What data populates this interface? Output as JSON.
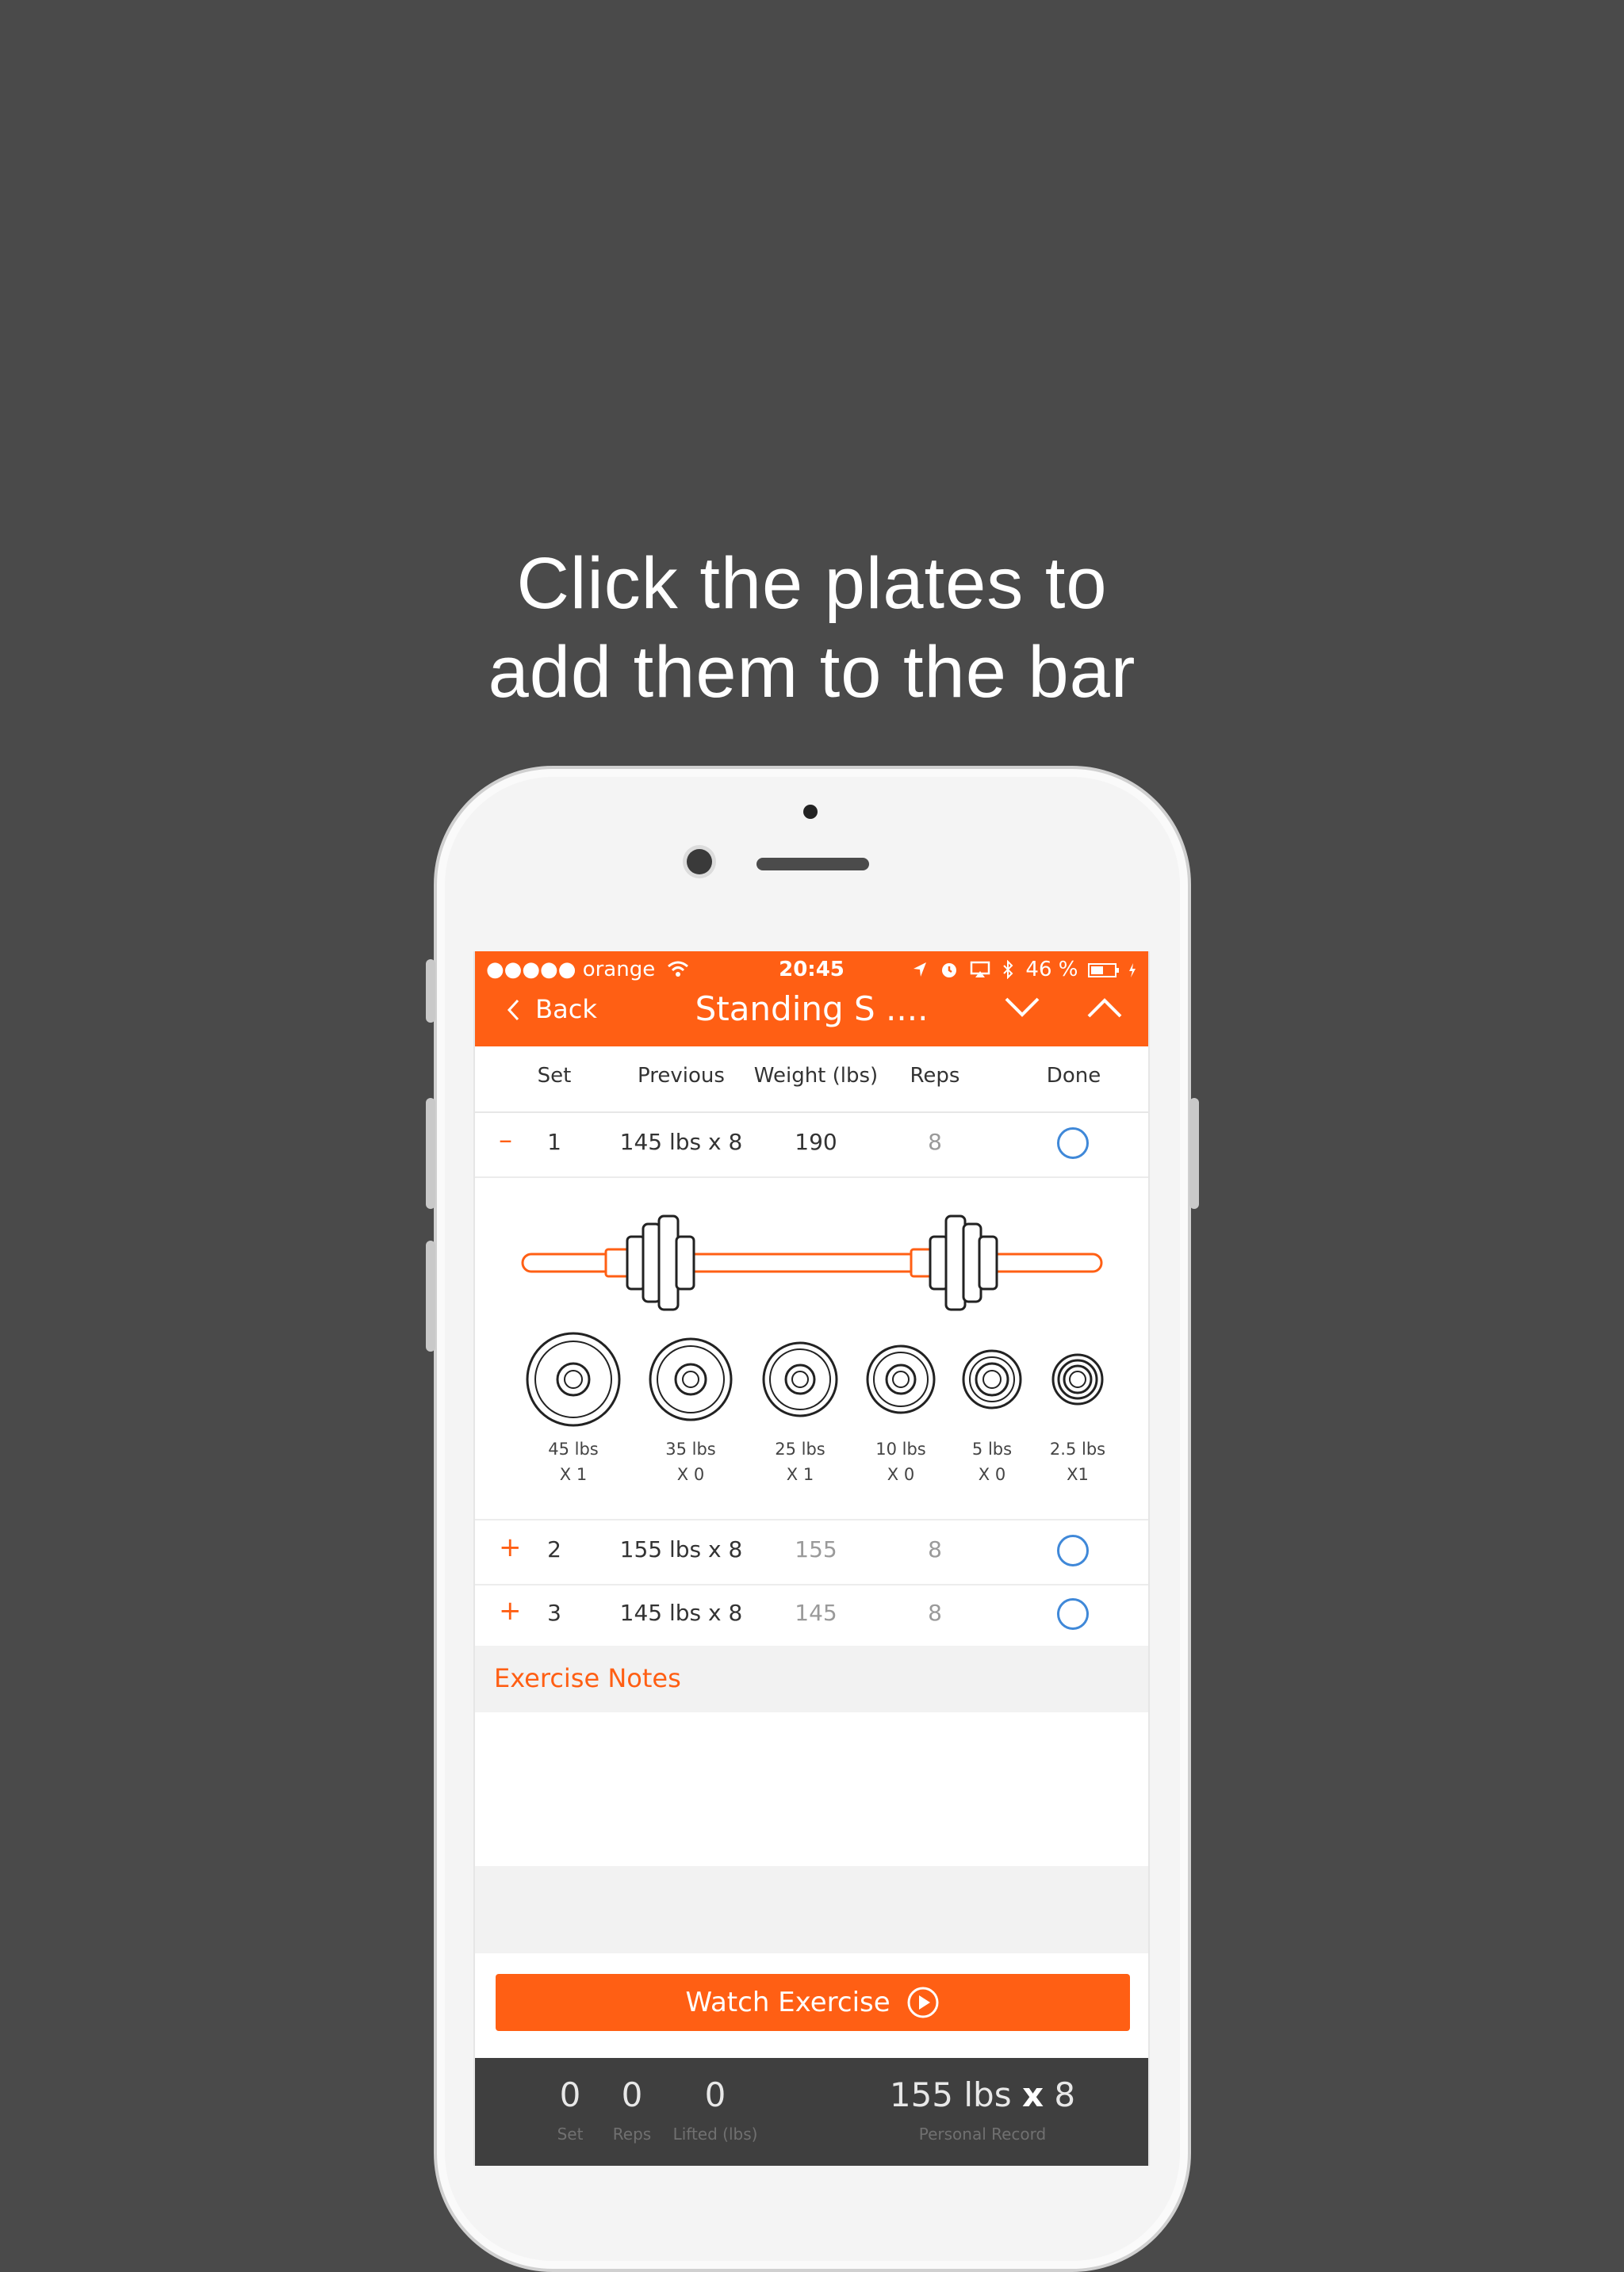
{
  "headline": {
    "line1": "Click the plates to",
    "line2": "add them to the bar"
  },
  "status_bar": {
    "carrier": "●●●●● orange",
    "time": "20:45",
    "battery": "46 %"
  },
  "nav": {
    "back_label": "Back",
    "title": "Standing S ...."
  },
  "table": {
    "headers": {
      "set": "Set",
      "previous": "Previous",
      "weight": "Weight (lbs)",
      "reps": "Reps",
      "done": "Done"
    },
    "rows": [
      {
        "sign": "–",
        "set": "1",
        "previous": "145 lbs x 8",
        "weight": "190",
        "reps": "8"
      },
      {
        "sign": "+",
        "set": "2",
        "previous": "155 lbs x 8",
        "weight": "155",
        "reps": "8"
      },
      {
        "sign": "+",
        "set": "3",
        "previous": "145 lbs x 8",
        "weight": "145",
        "reps": "8"
      }
    ]
  },
  "plates": [
    {
      "weight": "45 lbs",
      "count": "X 1"
    },
    {
      "weight": "35 lbs",
      "count": "X 0"
    },
    {
      "weight": "25 lbs",
      "count": "X 1"
    },
    {
      "weight": "10 lbs",
      "count": "X 0"
    },
    {
      "weight": "5 lbs",
      "count": "X 0"
    },
    {
      "weight": "2.5 lbs",
      "count": "X1"
    }
  ],
  "notes": {
    "label": "Exercise Notes"
  },
  "watch": {
    "label": "Watch Exercise"
  },
  "footer": {
    "set_value": "0",
    "set_label": "Set",
    "reps_value": "0",
    "reps_label": "Reps",
    "lifted_value": "0",
    "lifted_label": "Lifted (lbs)",
    "record_weight": "155 lbs",
    "record_x": "x",
    "record_reps": "8",
    "record_label": "Personal Record"
  },
  "colors": {
    "accent": "#ff5f14",
    "done_circle": "#3f88d8",
    "background": "#4a4a4a"
  }
}
